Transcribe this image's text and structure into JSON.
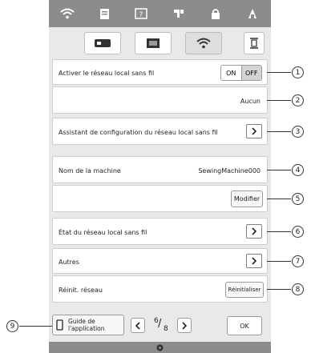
{
  "topbar": {
    "icons": [
      "wifi-icon",
      "document-icon",
      "help-icon",
      "needle-icon",
      "lock-icon",
      "home-icon"
    ]
  },
  "tabs": [
    {
      "icon": "machine-icon"
    },
    {
      "icon": "screen-icon"
    },
    {
      "icon": "wifi-icon"
    }
  ],
  "settings": {
    "wireless": {
      "label": "Activer le réseau local sans fil",
      "on": "ON",
      "off": "OFF"
    },
    "network_value": "Aucun",
    "wizard": {
      "label": "Assistant de configuration du réseau local sans fil"
    },
    "machine_name": {
      "label": "Nom de la machine",
      "value": "SewingMachine000"
    },
    "modify": {
      "label": "Modifier"
    },
    "status": {
      "label": "État du réseau local sans fil"
    },
    "others": {
      "label": "Autres"
    },
    "reset": {
      "label": "Réinit. réseau",
      "button": "Réinitialiser"
    }
  },
  "bottom": {
    "guide_line1": "Guide de",
    "guide_line2": "l'application",
    "page_num": "6",
    "page_den": "8",
    "ok": "OK"
  },
  "callouts": [
    "1",
    "2",
    "3",
    "4",
    "5",
    "6",
    "7",
    "8",
    "9"
  ]
}
